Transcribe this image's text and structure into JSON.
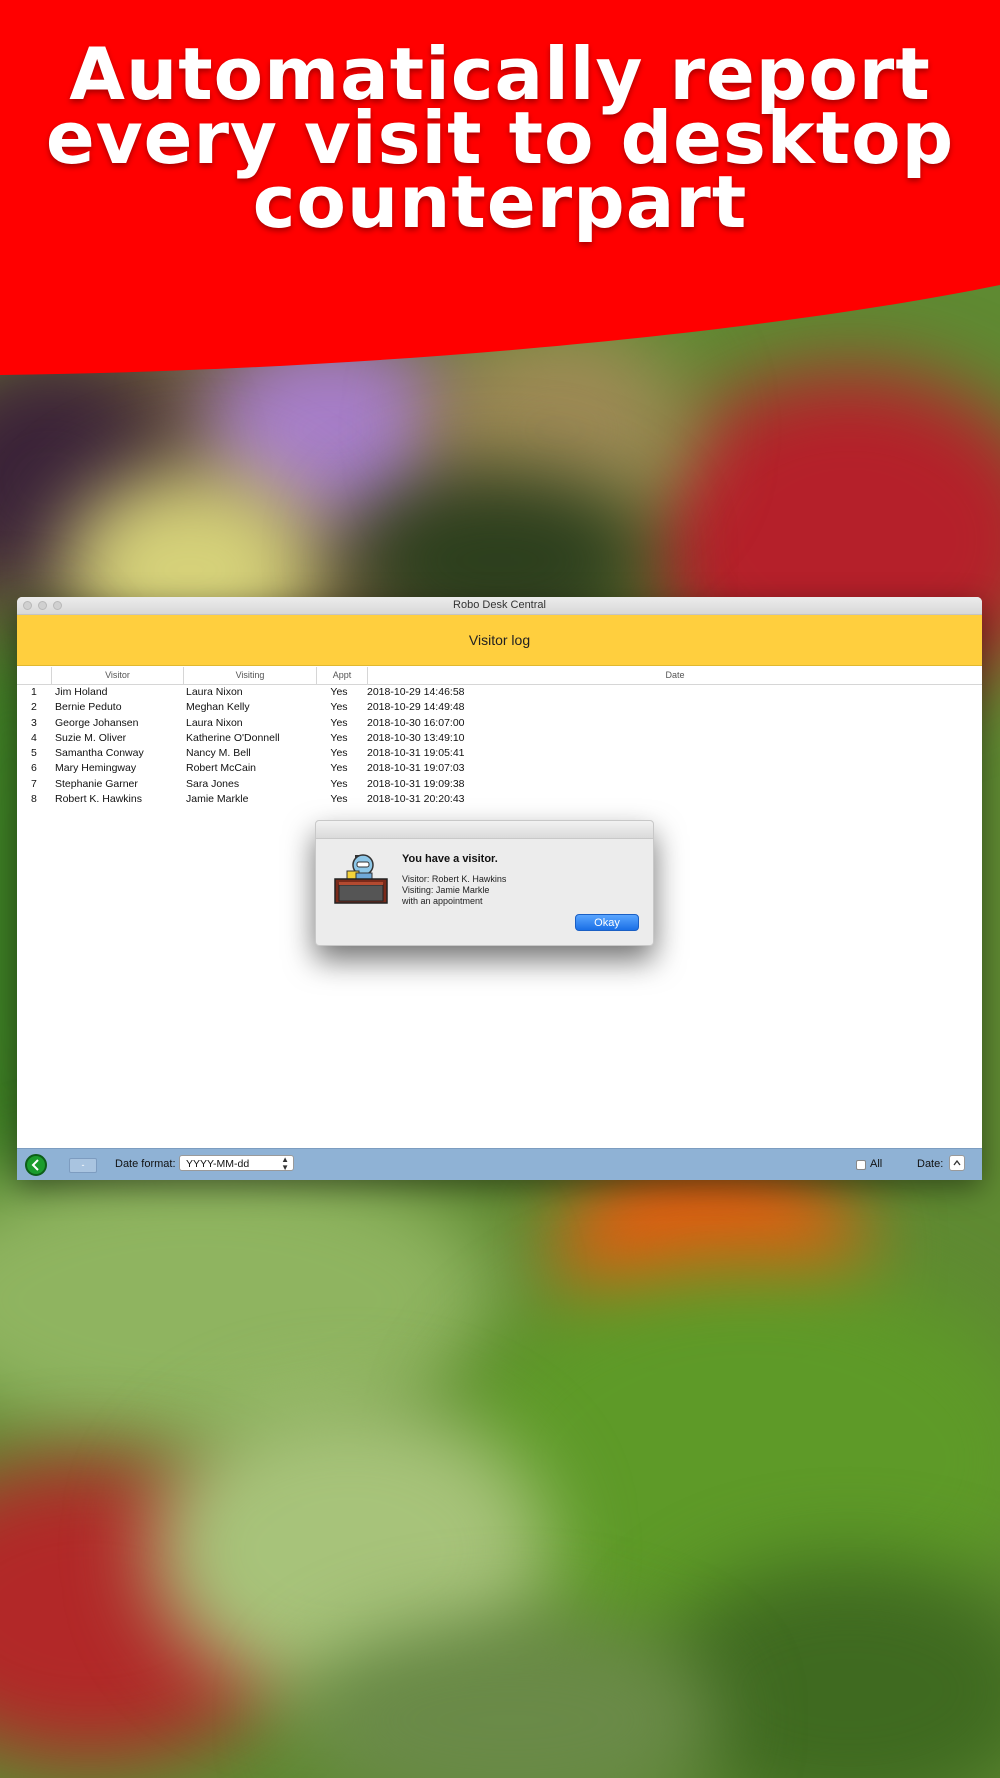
{
  "banner": {
    "headline": "Automatically report\nevery visit to desktop\ncounterpart",
    "color": "#ff0000"
  },
  "window": {
    "title": "Robo Desk Central",
    "header_title": "Visitor log",
    "header_color": "#ffcf3e",
    "columns": [
      "",
      "Visitor",
      "Visiting",
      "Appt",
      "Date"
    ],
    "rows": [
      [
        "1",
        "Jim Holand",
        "Laura Nixon",
        "Yes",
        "2018-10-29 14:46:58"
      ],
      [
        "2",
        "Bernie Peduto",
        "Meghan Kelly",
        "Yes",
        "2018-10-29 14:49:48"
      ],
      [
        "3",
        "George Johansen",
        "Laura Nixon",
        "Yes",
        "2018-10-30 16:07:00"
      ],
      [
        "4",
        "Suzie M. Oliver",
        "Katherine O'Donnell",
        "Yes",
        "2018-10-30 13:49:10"
      ],
      [
        "5",
        "Samantha Conway",
        "Nancy M. Bell",
        "Yes",
        "2018-10-31 19:05:41"
      ],
      [
        "6",
        "Mary Hemingway",
        "Robert McCain",
        "Yes",
        "2018-10-31 19:07:03"
      ],
      [
        "7",
        "Stephanie Garner",
        "Sara Jones",
        "Yes",
        "2018-10-31 19:09:38"
      ],
      [
        "8",
        "Robert K. Hawkins",
        "Jamie Markle",
        "Yes",
        "2018-10-31 20:20:43"
      ]
    ]
  },
  "bottom_bar": {
    "back_icon": "chevron-left-icon",
    "minus_label": "-",
    "date_format_label": "Date format:",
    "date_format_value": "YYYY-MM-dd",
    "all_label": "All",
    "all_checked": false,
    "date_label": "Date:",
    "date_button_icon": "chevron-up-icon"
  },
  "dialog": {
    "title": "You have a visitor.",
    "lines": [
      "Visitor: Robert K. Hawkins",
      "Visiting: Jamie Markle",
      "with an appointment"
    ],
    "button_label": "Okay",
    "icon": "robot-receptionist-icon"
  }
}
